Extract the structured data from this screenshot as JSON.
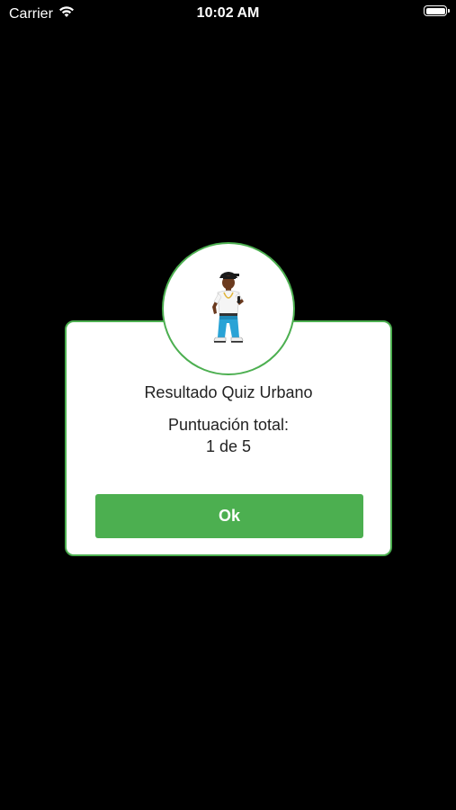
{
  "status_bar": {
    "carrier": "Carrier",
    "time": "10:02 AM"
  },
  "dialog": {
    "title": "Resultado Quiz Urbano",
    "score_label": "Puntuación total:",
    "score_value": "1 de 5",
    "ok_label": "Ok"
  },
  "colors": {
    "accent": "#4caf50",
    "background": "#000000",
    "dialog_background": "#ffffff"
  },
  "icons": {
    "avatar": "rapper-character-icon"
  }
}
